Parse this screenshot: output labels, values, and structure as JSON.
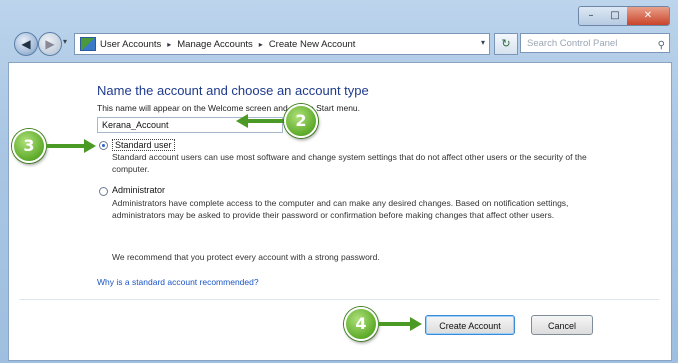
{
  "window": {
    "controls": {
      "minimize": "–",
      "maximize": "□",
      "close": "✕"
    }
  },
  "nav": {
    "back": "◀",
    "forward": "▶",
    "breadcrumbs": [
      "User Accounts",
      "Manage Accounts",
      "Create New Account"
    ],
    "separator": "▸",
    "refresh": "↻",
    "search_placeholder": "Search Control Panel"
  },
  "form": {
    "title": "Name the account and choose an account type",
    "note": "This name will appear on the Welcome screen and on the Start menu.",
    "account_name": "Kerana_Account",
    "options": [
      {
        "label": "Standard user",
        "selected": true,
        "description": "Standard account users can use most software and change system settings that do not affect other users or the security of the computer."
      },
      {
        "label": "Administrator",
        "selected": false,
        "description": "Administrators have complete access to the computer and can make any desired changes. Based on notification settings, administrators may be asked to provide their password or confirmation before making changes that affect other users."
      }
    ],
    "recommendation": "We recommend that you protect every account with a strong password.",
    "why_link": "Why is a standard account recommended?",
    "create_button": "Create Account",
    "cancel_button": "Cancel"
  },
  "callouts": {
    "c2": "2",
    "c3": "3",
    "c4": "4"
  },
  "colors": {
    "callout_green": "#5eab2a",
    "title_blue": "#1e3a8c",
    "link_blue": "#1a55c4"
  }
}
